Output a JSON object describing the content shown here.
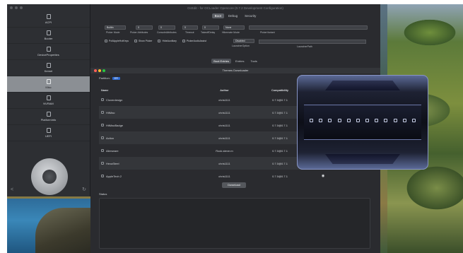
{
  "sidebar": {
    "items": [
      {
        "label": "ACPI",
        "icon": "document-icon"
      },
      {
        "label": "Booter",
        "icon": "document-icon"
      },
      {
        "label": "DeviceProperties",
        "icon": "document-icon"
      },
      {
        "label": "Kernel",
        "icon": "document-icon"
      },
      {
        "label": "Misc",
        "icon": "document-icon",
        "active": true
      },
      {
        "label": "NVRAM",
        "icon": "document-icon"
      },
      {
        "label": "PlatformInfo",
        "icon": "document-icon"
      },
      {
        "label": "UEFI",
        "icon": "document-icon"
      }
    ]
  },
  "main": {
    "title": "OcEdit - for OCLoader Opencore (0.7.2 Development Configuration)",
    "tabs": [
      "Boot",
      "Debug",
      "Security"
    ],
    "fields": {
      "picker_mode": {
        "value": "Builtin",
        "label": "Picker Mode"
      },
      "picker_attributes": {
        "value": "0",
        "label": "Picker Attributes"
      },
      "console_attributes": {
        "value": "0",
        "label": "ConsoleAttributes"
      },
      "timeout": {
        "value": "0",
        "label": "Timeout"
      },
      "takeoff_delay": {
        "value": "0",
        "label": "TakeoffDelay"
      },
      "hibernate_mode": {
        "value": "None",
        "label": "Hibernate Mode"
      },
      "picker_variant": {
        "value": "",
        "label": "PickerVariant"
      }
    },
    "checkboxes": [
      "PollAppleHotKeys",
      "Show Picker",
      "HideAuxiliary",
      "PickerAudioAssist"
    ],
    "launcher_option": {
      "value": "Disabled",
      "label": "LauncherOption"
    },
    "launcher_path": {
      "label": "LauncherPath"
    },
    "subtabs": [
      "Boot Entries",
      "Entries",
      "Tools"
    ]
  },
  "downloader": {
    "title": "Themes Downloader",
    "partition_label": "Partition:",
    "partition_value": "EFI",
    "columns": [
      "Name",
      "Author",
      "Compatibility",
      "Preview"
    ],
    "rows": [
      {
        "name": "Cloverdesign",
        "author": "chris1111",
        "compat": "0.7.0@0.7.1"
      },
      {
        "name": "HitMac",
        "author": "chris1111",
        "compat": "0.7.0@0.7.1"
      },
      {
        "name": "HitMacBadge",
        "author": "chris1111",
        "compat": "0.7.0@0.7.1"
      },
      {
        "name": "Action",
        "author": "chris1111",
        "compat": "0.7.0@0.7.1"
      },
      {
        "name": "Alienware",
        "author": "Rock.steve.rn",
        "compat": "0.7.0@0.7.1"
      },
      {
        "name": "HexaSteel",
        "author": "chris1111",
        "compat": "0.7.0@0.7.1"
      },
      {
        "name": "AppleTech 2",
        "author": "chris1111",
        "compat": "0.7.0@0.7.1"
      }
    ],
    "download_label": "Download",
    "status_label": "Status"
  },
  "skin_preview": {
    "icon_count": 12,
    "accent": "#6b78a8"
  }
}
